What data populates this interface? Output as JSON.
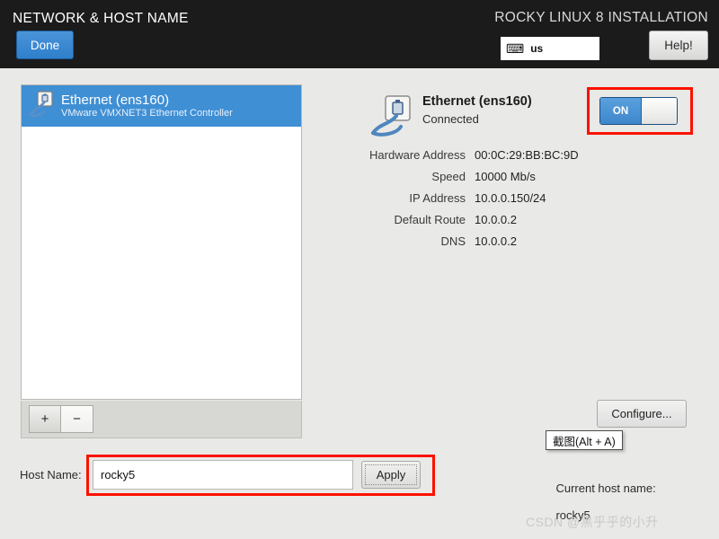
{
  "header": {
    "title": "NETWORK & HOST NAME",
    "installer_title": "ROCKY LINUX 8 INSTALLATION",
    "done_label": "Done",
    "help_label": "Help!",
    "keyboard_layout": "us",
    "keyboard_icon": "keyboard-icon"
  },
  "device_list": {
    "items": [
      {
        "name": "Ethernet (ens160)",
        "description": "VMware VMXNET3 Ethernet Controller",
        "icon": "wired-network-icon",
        "selected": true
      }
    ],
    "add_label": "+",
    "remove_label": "−"
  },
  "detail": {
    "title": "Ethernet (ens160)",
    "status": "Connected",
    "icon": "wired-network-icon",
    "rows": [
      {
        "label": "Hardware Address",
        "value": "00:0C:29:BB:BC:9D"
      },
      {
        "label": "Speed",
        "value": "10000 Mb/s"
      },
      {
        "label": "IP Address",
        "value": "10.0.0.150/24"
      },
      {
        "label": "Default Route",
        "value": "10.0.0.2"
      },
      {
        "label": "DNS",
        "value": "10.0.0.2"
      }
    ],
    "toggle_label": "ON",
    "toggle_state": "on",
    "configure_label": "Configure..."
  },
  "tooltip": {
    "text": "截图(Alt + A)"
  },
  "host": {
    "label": "Host Name:",
    "value": "rocky5",
    "apply_label": "Apply",
    "current_label": "Current host name:",
    "current_value": "rocky5"
  },
  "watermark": {
    "text": "CSDN @黑乎乎的小升"
  },
  "colors": {
    "header_bg": "#1b1b1b",
    "body_bg": "#e9e9e7",
    "accent_blue": "#3f8fd4",
    "annotation_red": "#fc1100"
  }
}
